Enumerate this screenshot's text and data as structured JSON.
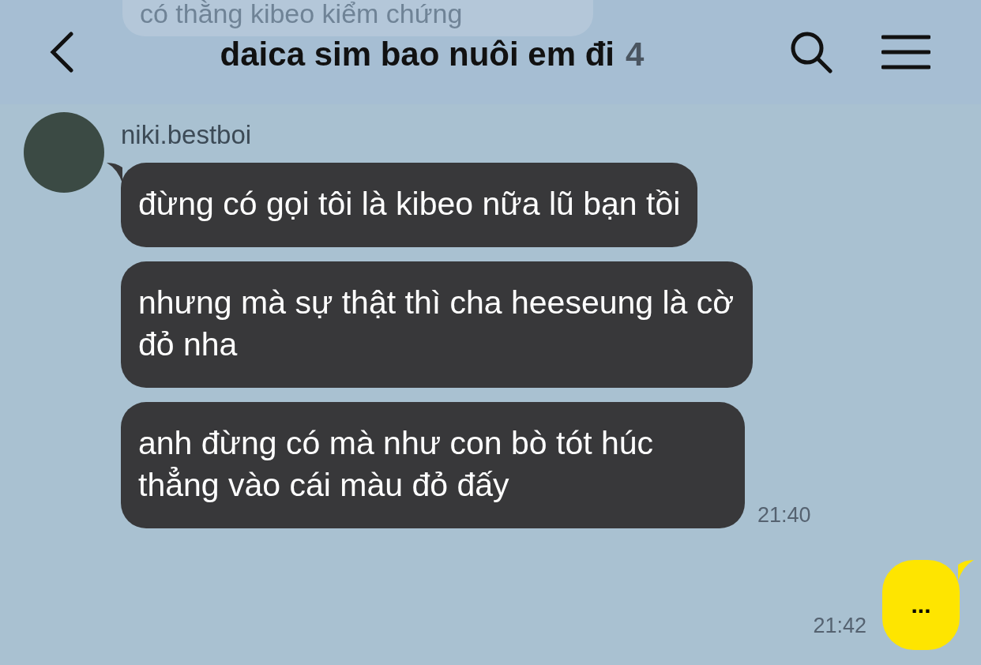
{
  "header": {
    "title": "daica sim bao nuôi em đi",
    "member_count": "4"
  },
  "scrolled_message": {
    "text": "có thằng kibeo kiểm chứng"
  },
  "sender": {
    "name": "niki.bestboi"
  },
  "messages": [
    {
      "kind": "received",
      "text": "đừng có gọi tôi là kibeo nữa lũ bạn tồi",
      "tail": true
    },
    {
      "kind": "received",
      "text": "nhưng mà sự thật thì cha heeseung là cờ đỏ nha",
      "tail": false
    },
    {
      "kind": "received",
      "text": "anh đừng có mà như con bò tót húc thẳng vào cái màu đỏ đấy",
      "tail": false,
      "time": "21:40"
    },
    {
      "kind": "sent",
      "text": "...",
      "tail": true,
      "time": "21:42"
    }
  ]
}
